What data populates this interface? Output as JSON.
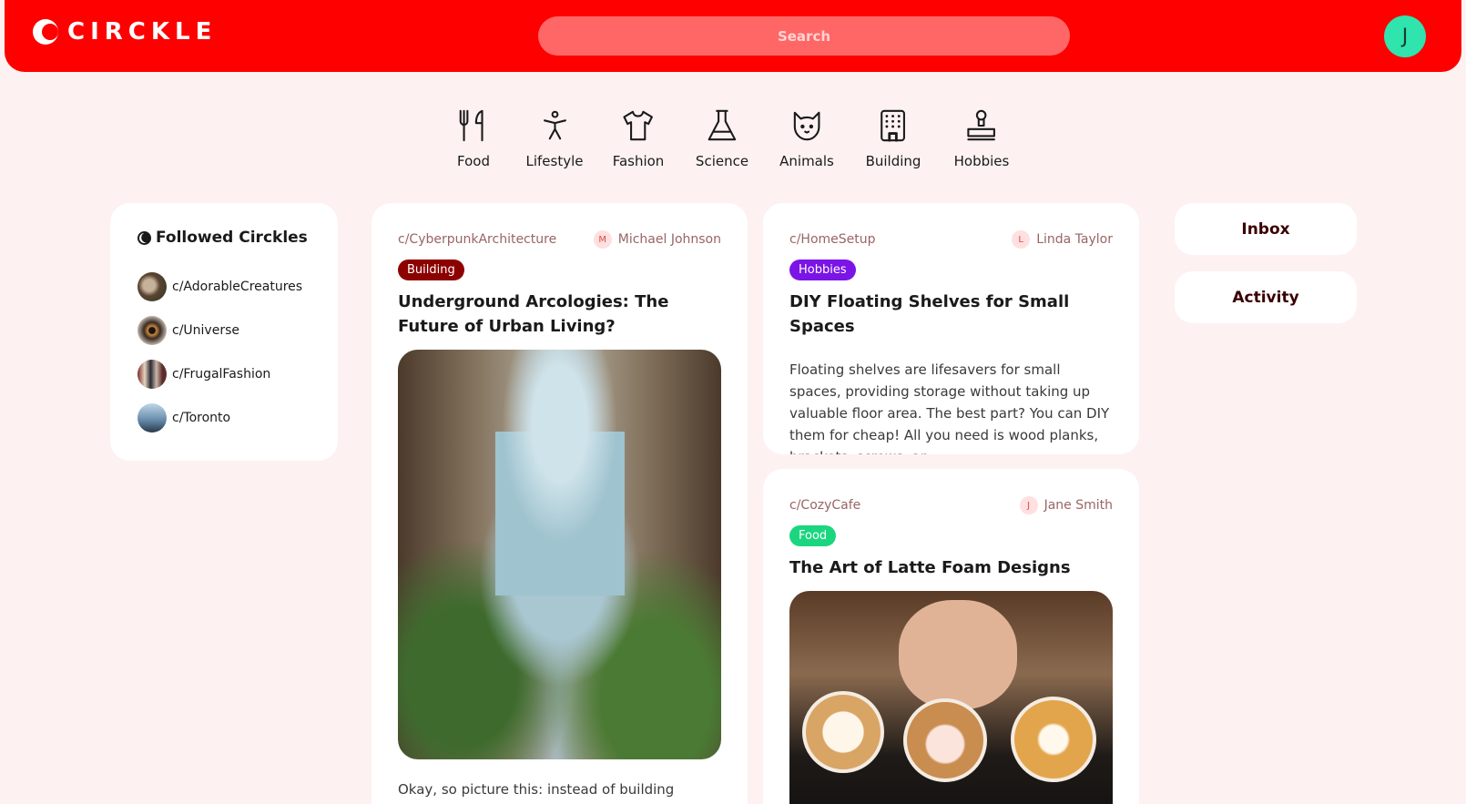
{
  "app": {
    "name": "CIRCKLE"
  },
  "search": {
    "placeholder": "Search"
  },
  "user": {
    "initial": "J",
    "avatar_color": "#2fe4ad"
  },
  "colors": {
    "brand": "#fe0000",
    "background": "#fdf2f1"
  },
  "categories": [
    {
      "label": "Food",
      "icon": "fork-knife-icon"
    },
    {
      "label": "Lifestyle",
      "icon": "person-icon"
    },
    {
      "label": "Fashion",
      "icon": "shirt-icon"
    },
    {
      "label": "Science",
      "icon": "flask-icon"
    },
    {
      "label": "Animals",
      "icon": "cat-icon"
    },
    {
      "label": "Building",
      "icon": "building-icon"
    },
    {
      "label": "Hobbies",
      "icon": "stamp-icon"
    }
  ],
  "followed": {
    "title": "Followed Circkles",
    "items": [
      {
        "label": "c/AdorableCreatures"
      },
      {
        "label": "c/Universe"
      },
      {
        "label": "c/FrugalFashion"
      },
      {
        "label": "c/Toronto"
      }
    ]
  },
  "posts": [
    {
      "circle": "c/CyberpunkArchitecture",
      "author_initial": "M",
      "author": "Michael Johnson",
      "tag": "Building",
      "tag_color": "#8c0000",
      "title": "Underground Arcologies: The Future of Urban Living?",
      "excerpt": "Okay, so picture this: instead of building"
    },
    {
      "circle": "c/HomeSetup",
      "author_initial": "L",
      "author": "Linda Taylor",
      "tag": "Hobbies",
      "tag_color": "#7b14e6",
      "title": "DIY Floating Shelves for Small Spaces",
      "excerpt": "Floating shelves are lifesavers for small spaces, providing storage without taking up valuable floor area. The best part? You can DIY them for cheap! All you need is wood planks, brackets, screws, an..."
    },
    {
      "circle": "c/CozyCafe",
      "author_initial": "J",
      "author": "Jane Smith",
      "tag": "Food",
      "tag_color": "#1bd67f",
      "title": "The Art of Latte Foam Designs"
    }
  ],
  "side": {
    "inbox": "Inbox",
    "activity": "Activity"
  }
}
